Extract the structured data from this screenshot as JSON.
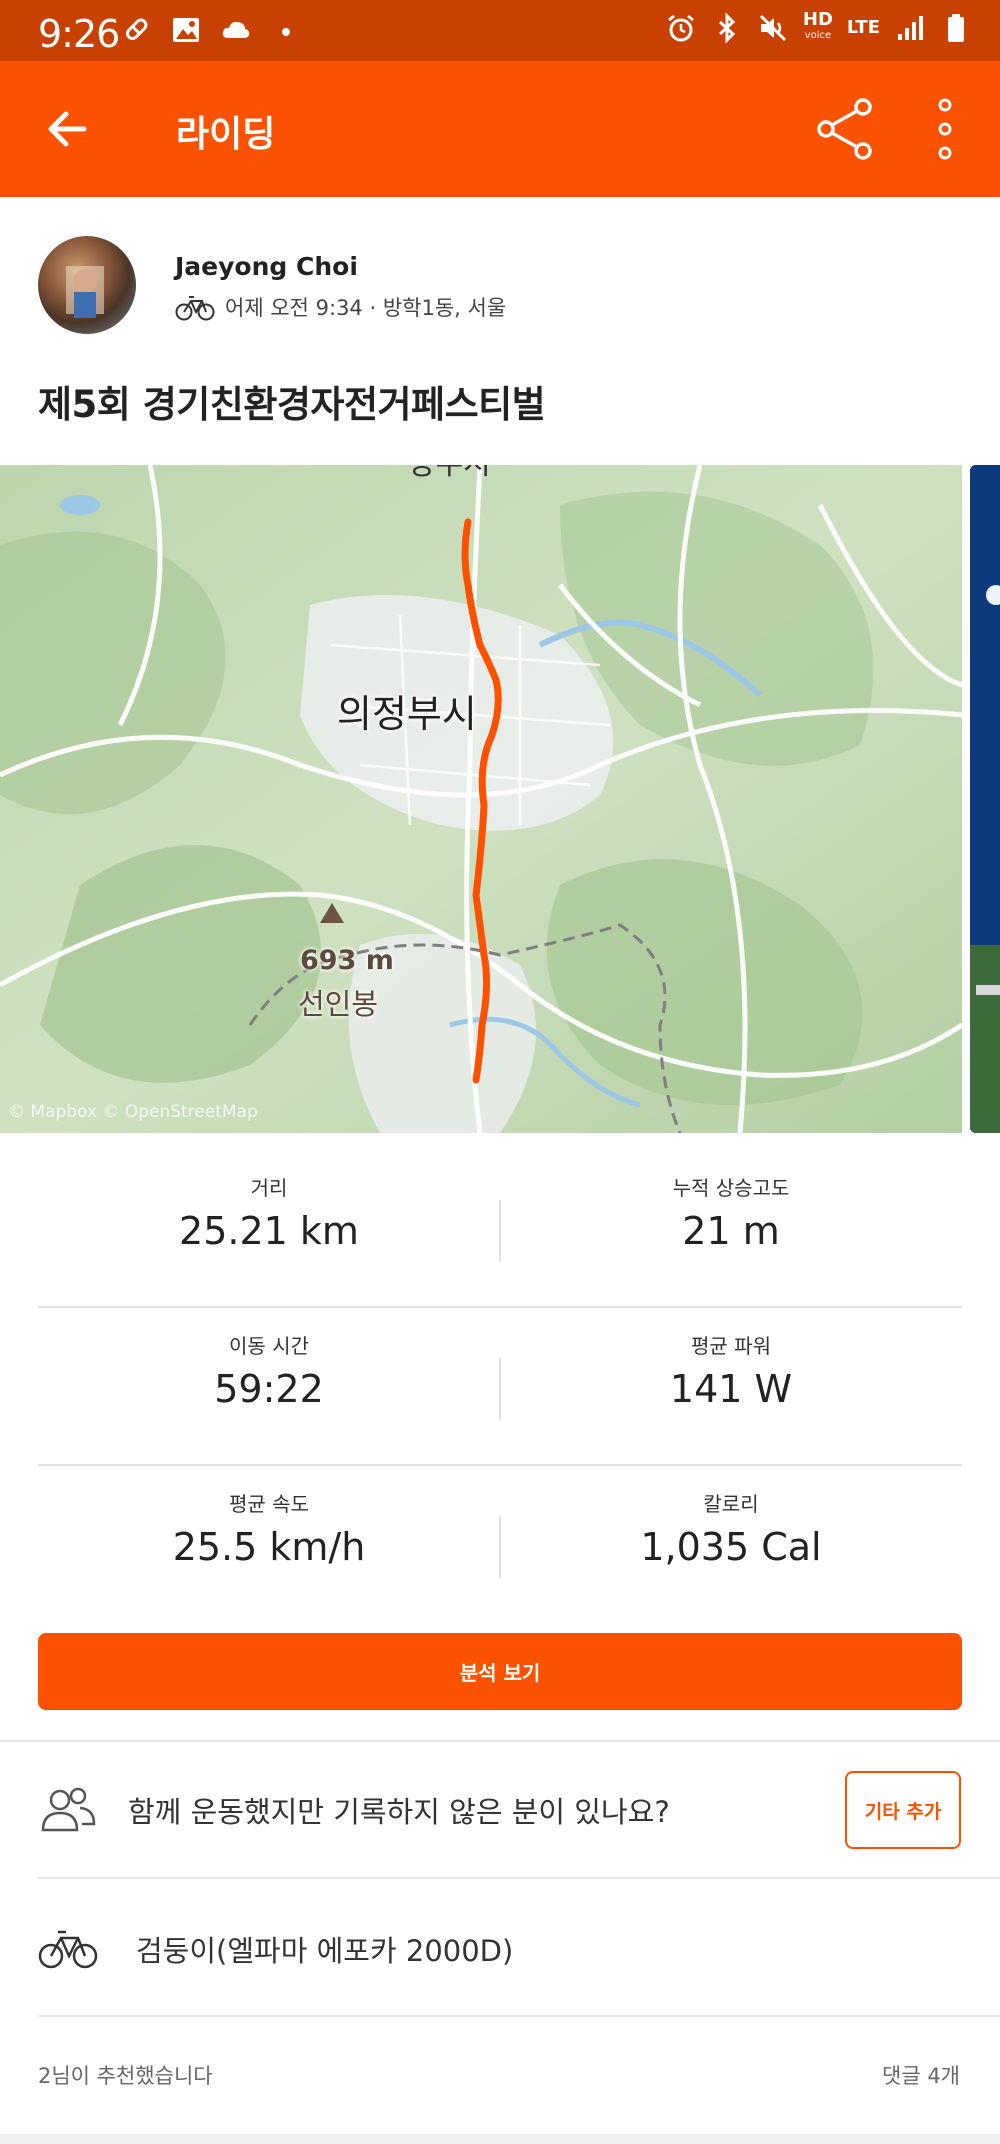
{
  "status_bar": {
    "time": "9:26",
    "network": "HD",
    "network_sub": "voice",
    "lte": "LTE",
    "bg_color": "#c94100"
  },
  "app_bar": {
    "title": "라이딩",
    "bg_color": "#fc5200",
    "back_icon": "arrow-left-icon",
    "share_icon": "share-icon",
    "more_icon": "more-vertical-icon"
  },
  "athlete": {
    "name": "Jaeyong Choi",
    "meta": "어제 오전 9:34 · 방학1동, 서울",
    "sport_icon": "bike-icon"
  },
  "activity": {
    "title": "제5회 경기친환경자전거페스티벌"
  },
  "map": {
    "city_label": "의정부시",
    "peak_elevation": "693 m",
    "peak_name": "선인봉",
    "top_label_partial": "양주시",
    "credit": "© Mapbox © OpenStreetMap",
    "route_color": "#fc5200"
  },
  "stats": [
    [
      {
        "label": "거리",
        "value": "25.21 km"
      },
      {
        "label": "누적 상승고도",
        "value": "21 m"
      }
    ],
    [
      {
        "label": "이동 시간",
        "value": "59:22"
      },
      {
        "label": "평균 파워",
        "value": "141 W"
      }
    ],
    [
      {
        "label": "평균 속도",
        "value": "25.5 km/h"
      },
      {
        "label": "칼로리",
        "value": "1,035 Cal"
      }
    ]
  ],
  "actions": {
    "analysis_label": "분석 보기",
    "prompt": "함께 운동했지만 기록하지 않은 분이 있나요?",
    "add_others_label": "기타 추가"
  },
  "gear": {
    "name": "검둥이(엘파마 에포카 2000D)"
  },
  "footer": {
    "kudos": "2님이 추천했습니다",
    "comments": "댓글 4개"
  }
}
